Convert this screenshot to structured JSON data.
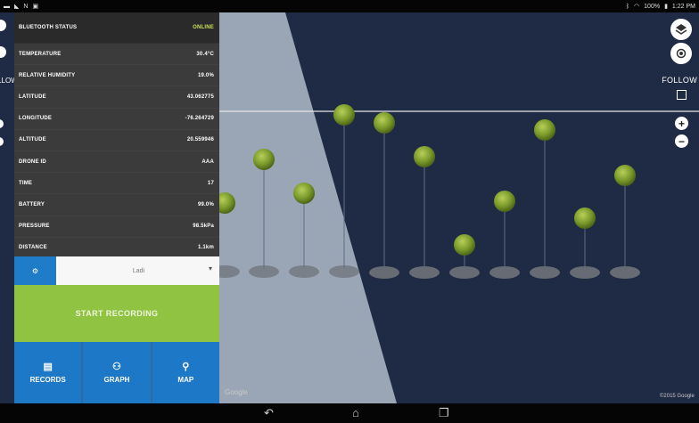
{
  "status_bar": {
    "left_icons": [
      "video-icon",
      "signal-icon",
      "notification-icon",
      "image-icon"
    ],
    "right_icons": [
      "bluetooth-icon",
      "wifi-icon"
    ],
    "battery": "100%",
    "clock": "1:22 PM"
  },
  "left_edge": {
    "follow_label": "FOLLOW"
  },
  "panel": {
    "header": {
      "label": "BLUETOOTH STATUS",
      "value": "ONLINE"
    },
    "rows": [
      {
        "label": "TEMPERATURE",
        "value": "30.4°C"
      },
      {
        "label": "RELATIVE HUMIDITY",
        "value": "19.0%"
      },
      {
        "label": "LATITUDE",
        "value": "43.062775"
      },
      {
        "label": "LONGITUDE",
        "value": "-76.264729"
      },
      {
        "label": "ALTITUDE",
        "value": "20.559946"
      },
      {
        "label": "DRONE ID",
        "value": "AAA"
      },
      {
        "label": "TIME",
        "value": "17"
      },
      {
        "label": "BATTERY",
        "value": "99.0%"
      },
      {
        "label": "PRESSURE",
        "value": "98.5kPa"
      },
      {
        "label": "DISTANCE",
        "value": "1.1km"
      }
    ],
    "select_button": "⚙",
    "select_value": "Ladi",
    "record_button": "START RECORDING",
    "tabs": [
      {
        "label": "RECORDS",
        "icon": "records-icon"
      },
      {
        "label": "GRAPH",
        "icon": "graph-icon"
      },
      {
        "label": "MAP",
        "icon": "map-pin-icon"
      }
    ]
  },
  "map": {
    "follow_label": "FOLLOW",
    "zoom_in": "+",
    "zoom_out": "−",
    "logo_text": "Google",
    "credit_text": "©2015 Google"
  },
  "nav_bar": {
    "buttons": [
      "back-icon",
      "home-icon",
      "recents-icon"
    ]
  },
  "colors": {
    "map_background": "#1f2a44",
    "panel_background": "#3b3b3b",
    "accent_blue": "#1e78c8",
    "record_green": "#8fc341",
    "status_online": "#c8e157",
    "marker_green": "#6f8f26"
  }
}
